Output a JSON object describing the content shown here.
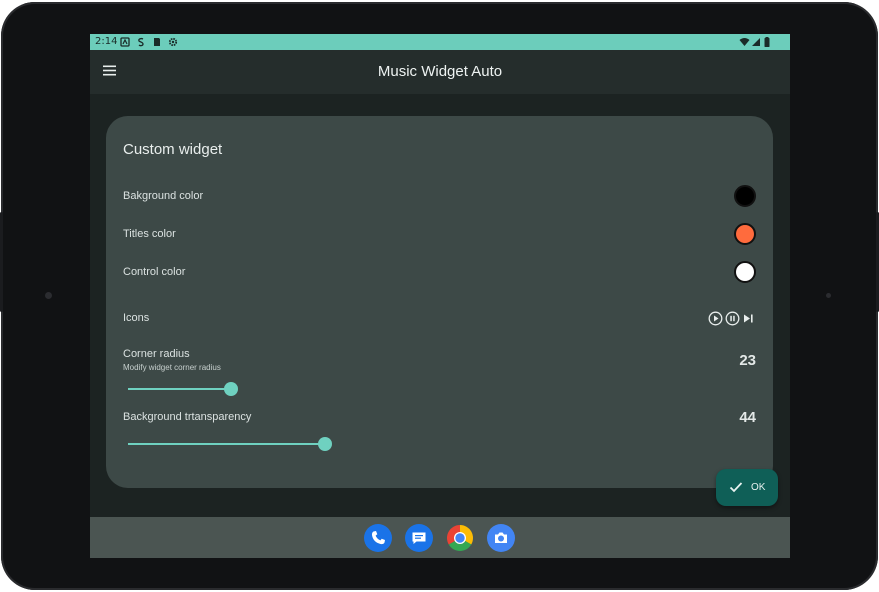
{
  "statusbar": {
    "time": "2:14",
    "left_icons": [
      "notification-a-icon",
      "notification-s-icon",
      "sd-card-icon",
      "settings-icon"
    ],
    "right_icons": [
      "wifi-icon",
      "cell-signal-icon",
      "battery-icon"
    ]
  },
  "appbar": {
    "title": "Music Widget Auto",
    "menu_icon": "hamburger-menu-icon"
  },
  "card": {
    "title": "Custom widget",
    "background_color": {
      "label": "Bakground color",
      "value": "#000000"
    },
    "titles_color": {
      "label": "Titles color",
      "value": "#ff6b3d"
    },
    "control_color": {
      "label": "Control color",
      "value": "#ffffff"
    },
    "icons": {
      "label": "Icons",
      "set": [
        "play-circle-icon",
        "pause-circle-icon",
        "skip-next-icon"
      ]
    },
    "corner_radius": {
      "label": "Corner radius",
      "sublabel": "Modify widget corner radius",
      "value": "23",
      "fraction": 0.23
    },
    "background_transparency": {
      "label": "Background trtansparency",
      "value": "44",
      "fraction": 0.44
    }
  },
  "ok_button": {
    "label": "OK",
    "icon": "check-icon"
  },
  "dock": {
    "apps": [
      "phone-icon",
      "messages-icon",
      "chrome-icon",
      "camera-icon"
    ]
  },
  "colors": {
    "accent": "#6fd1c0",
    "statusbar": "#6ccdbb",
    "card": "#3d4947",
    "ok_button": "#0f5f57"
  }
}
